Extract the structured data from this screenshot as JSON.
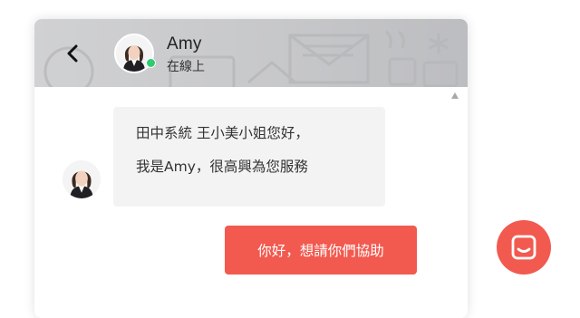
{
  "header": {
    "agent_name": "Amy",
    "agent_status": "在線上",
    "status_color": "#2ecc71",
    "background_color": "#c9cacc"
  },
  "icons": {
    "back": "chevron-left-icon",
    "launcher": "chat-icon",
    "scroll_up": "triangle-up-icon"
  },
  "conversation": {
    "incoming": {
      "lines": [
        "田中系統 王小美小姐您好，",
        "我是Amy，很高興為您服務"
      ],
      "bubble_color": "#f3f3f3"
    },
    "outgoing": {
      "text": "你好，想請你們協助",
      "bubble_color": "#f25a4f"
    }
  },
  "launcher": {
    "color": "#f25a4f"
  }
}
